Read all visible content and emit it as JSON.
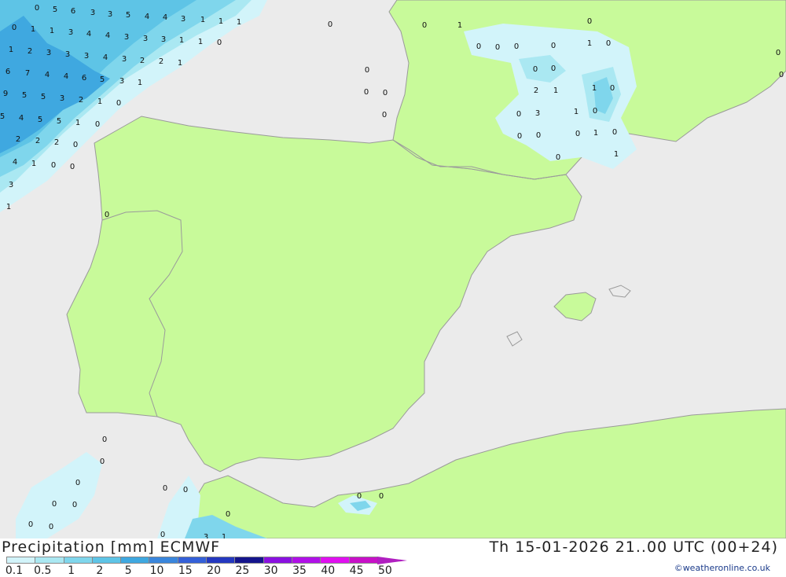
{
  "map": {
    "colors": {
      "sea": "#ebebeb",
      "land": "#c8fa9a",
      "border": "#9a9a9a",
      "precip_0": "#d2f4fa",
      "precip_05": "#aae8f2",
      "precip_1": "#7fd6ec",
      "precip_2": "#5ec4e6",
      "precip_5": "#3fa8e0"
    },
    "values": [
      "0",
      "5",
      "6",
      "3",
      "3",
      "5",
      "4",
      "4",
      "3",
      "1",
      "1",
      "1",
      "0",
      "1",
      "1",
      "3",
      "4",
      "4",
      "3",
      "3",
      "3",
      "1",
      "1",
      "0",
      "1",
      "2",
      "3",
      "3",
      "3",
      "4",
      "3",
      "2",
      "2",
      "1",
      "6",
      "7",
      "4",
      "4",
      "6",
      "5",
      "3",
      "1",
      "9",
      "5",
      "5",
      "3",
      "2",
      "1",
      "0",
      "5",
      "4",
      "5",
      "5",
      "1",
      "0",
      "2",
      "2",
      "2",
      "0",
      "4",
      "1",
      "0",
      "0",
      "3",
      "1",
      "0",
      "0",
      "0",
      "0",
      "0",
      "0",
      "0",
      "1",
      "0",
      "0",
      "0",
      "0",
      "1",
      "0",
      "0",
      "0",
      "0",
      "2",
      "1",
      "1",
      "0",
      "0",
      "3",
      "1",
      "0",
      "0",
      "0",
      "0",
      "1",
      "0",
      "1",
      "0",
      "0",
      "0",
      "0",
      "0",
      "0",
      "0",
      "0",
      "0",
      "0",
      "0",
      "0",
      "0",
      "0",
      "0",
      "3",
      "1",
      "0"
    ]
  },
  "footer": {
    "title": "Precipitation [mm] ECMWF",
    "datetime": "Th 15-01-2026 21..00 UTC (00+24)",
    "credit": "©weatheronline.co.uk",
    "legend": {
      "labels": [
        "0.1",
        "0.5",
        "1",
        "2",
        "5",
        "10",
        "15",
        "20",
        "25",
        "30",
        "35",
        "40",
        "45",
        "50"
      ],
      "colors": [
        "#d2f4fa",
        "#aae8f2",
        "#7fd6ec",
        "#5ec4e6",
        "#3fa8e0",
        "#3a86dc",
        "#3460d8",
        "#2438c0",
        "#14148c",
        "#8a10e0",
        "#b010e8",
        "#e010f0",
        "#c810c8",
        "#b01fc0"
      ]
    }
  }
}
